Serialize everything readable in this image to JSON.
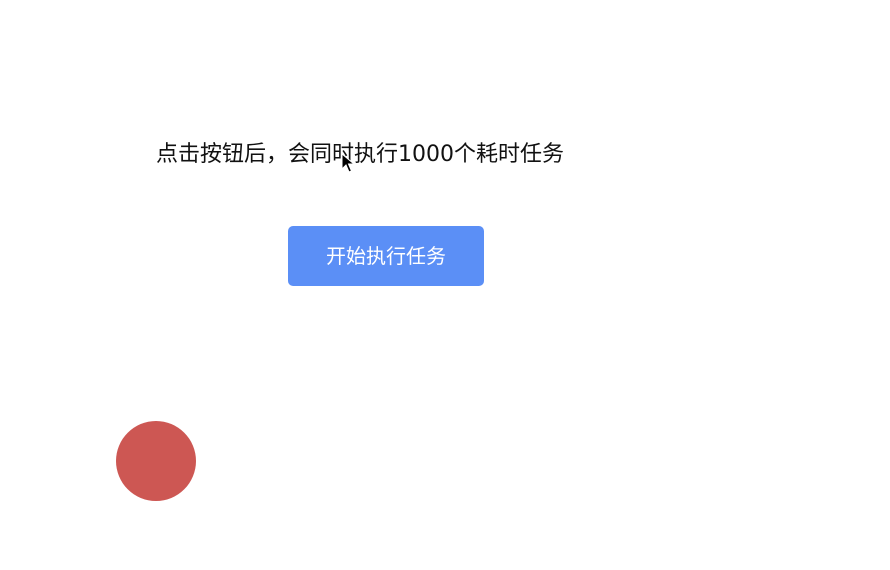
{
  "main": {
    "description": "点击按钮后，会同时执行1000个耗时任务",
    "start_button_label": "开始执行任务"
  },
  "colors": {
    "button_bg": "#5b8ff6",
    "ball": "#cd5753"
  }
}
